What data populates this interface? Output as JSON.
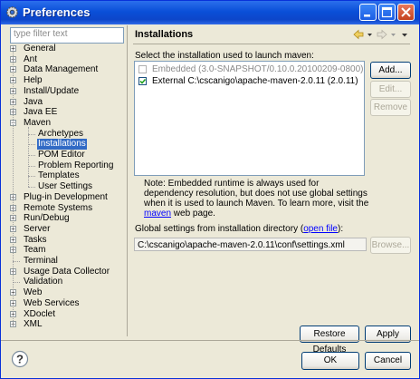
{
  "window": {
    "title": "Preferences"
  },
  "filter": {
    "placeholder": "type filter text"
  },
  "tree": [
    {
      "label": "General",
      "expander": true
    },
    {
      "label": "Ant",
      "expander": true
    },
    {
      "label": "Data Management",
      "expander": true
    },
    {
      "label": "Help",
      "expander": true
    },
    {
      "label": "Install/Update",
      "expander": true
    },
    {
      "label": "Java",
      "expander": true
    },
    {
      "label": "Java EE",
      "expander": true
    },
    {
      "label": "Maven",
      "expander": true,
      "expanded": true
    },
    {
      "label": "Archetypes",
      "child": true
    },
    {
      "label": "Installations",
      "child": true,
      "selected": true
    },
    {
      "label": "POM Editor",
      "child": true
    },
    {
      "label": "Problem Reporting",
      "child": true
    },
    {
      "label": "Templates",
      "child": true
    },
    {
      "label": "User Settings",
      "child": true
    },
    {
      "label": "Plug-in Development",
      "expander": true
    },
    {
      "label": "Remote Systems",
      "expander": true
    },
    {
      "label": "Run/Debug",
      "expander": true
    },
    {
      "label": "Server",
      "expander": true
    },
    {
      "label": "Tasks",
      "expander": true
    },
    {
      "label": "Team",
      "expander": true
    },
    {
      "label": "Terminal",
      "expander": false
    },
    {
      "label": "Usage Data Collector",
      "expander": true
    },
    {
      "label": "Validation",
      "expander": false
    },
    {
      "label": "Web",
      "expander": true
    },
    {
      "label": "Web Services",
      "expander": true
    },
    {
      "label": "XDoclet",
      "expander": true
    },
    {
      "label": "XML",
      "expander": true
    }
  ],
  "panel": {
    "title": "Installations",
    "description": "Select the installation used to launch maven:",
    "installations": [
      {
        "label": "Embedded (3.0-SNAPSHOT/0.10.0.20100209-0800)",
        "checked": false,
        "disabled": true
      },
      {
        "label": "External C:\\cscanigo\\apache-maven-2.0.11 (2.0.11)",
        "checked": true,
        "disabled": false
      }
    ],
    "buttons": {
      "add": "Add...",
      "edit": "Edit...",
      "remove": "Remove"
    },
    "note": {
      "text1": "Note: Embedded runtime is always used for dependency resolution, but does not use global settings when it is used to launch Maven. To learn more, visit the ",
      "link": "maven",
      "text2": " web page."
    },
    "global_settings": {
      "label_before": "Global settings from installation directory (",
      "link": "open file",
      "label_after": "):",
      "path": "C:\\cscanigo\\apache-maven-2.0.11\\conf\\settings.xml",
      "browse": "Browse..."
    },
    "restore_defaults": "Restore Defaults",
    "apply": "Apply"
  },
  "footer": {
    "ok": "OK",
    "cancel": "Cancel"
  }
}
